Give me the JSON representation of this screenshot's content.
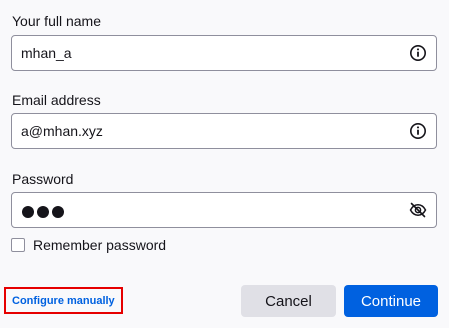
{
  "name_field": {
    "label": "Your full name",
    "value": "mhan_a",
    "icon": "info-icon"
  },
  "email_field": {
    "label": "Email address",
    "value": "a@mhan.xyz",
    "icon": "info-icon"
  },
  "password_field": {
    "label": "Password",
    "masked_length": 3,
    "icon": "eye-slash-icon"
  },
  "remember_password": {
    "label": "Remember password",
    "checked": false
  },
  "configure_manually": {
    "label": "Configure manually",
    "highlight_color": "#e60000"
  },
  "buttons": {
    "cancel_label": "Cancel",
    "continue_label": "Continue"
  },
  "colors": {
    "accent": "#0061e0",
    "text": "#15141a",
    "border": "#8f8f9d"
  }
}
